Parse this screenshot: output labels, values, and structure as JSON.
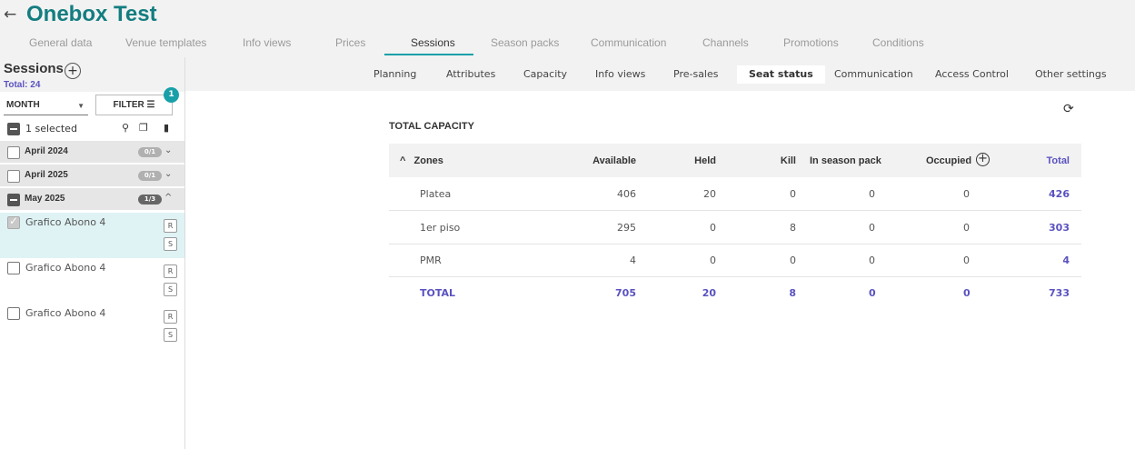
{
  "header": {
    "back_icon": "arrow-left-icon",
    "title": "Onebox Test",
    "tabs": [
      "General data",
      "Venue templates",
      "Info views",
      "Prices",
      "Sessions",
      "Season packs",
      "Communication",
      "Channels",
      "Promotions",
      "Conditions"
    ],
    "active_tab": "Sessions",
    "accent_color": "#147d80"
  },
  "sidebar": {
    "title": "Sessions",
    "add_label": "+",
    "total": "Total: 24",
    "month_select": "MONTH",
    "filter_label": "FILTER",
    "filter_badge": "1",
    "selected_text": "1 selected",
    "groups": [
      {
        "label": "April 2024",
        "count": "0/1",
        "chevron": "⌄"
      },
      {
        "label": "April 2025",
        "count": "0/1",
        "chevron": "⌄"
      },
      {
        "label": "May 2025",
        "count": "1/3",
        "chevron": "^"
      }
    ],
    "sessions": [
      {
        "name": "Grafico Abono 4",
        "tags": [
          "R",
          "S"
        ],
        "checked": true
      },
      {
        "name": "Grafico Abono 4",
        "tags": [
          "R",
          "S"
        ],
        "checked": false
      },
      {
        "name": "Grafico Abono 4",
        "tags": [
          "R",
          "S"
        ],
        "checked": false
      }
    ]
  },
  "subnav": {
    "tabs": [
      "Planning",
      "Attributes",
      "Capacity",
      "Info views",
      "Pre-sales",
      "Seat status",
      "Communication",
      "Access Control",
      "Other settings"
    ],
    "active": "Seat status"
  },
  "capacity": {
    "title": "TOTAL CAPACITY",
    "columns": [
      "Zones",
      "Available",
      "Held",
      "Kill",
      "In season pack",
      "Occupied",
      "Total"
    ],
    "rows": [
      {
        "zone": "Platea",
        "available": "406",
        "held": "20",
        "kill": "0",
        "season": "0",
        "occupied": "0",
        "total": "426"
      },
      {
        "zone": "1er piso",
        "available": "295",
        "held": "0",
        "kill": "8",
        "season": "0",
        "occupied": "0",
        "total": "303"
      },
      {
        "zone": "PMR",
        "available": "4",
        "held": "0",
        "kill": "0",
        "season": "0",
        "occupied": "0",
        "total": "4"
      }
    ],
    "total_row": {
      "zone": "TOTAL",
      "available": "705",
      "held": "20",
      "kill": "8",
      "season": "0",
      "occupied": "0",
      "total": "733"
    },
    "total_color": "#5a52c0"
  }
}
